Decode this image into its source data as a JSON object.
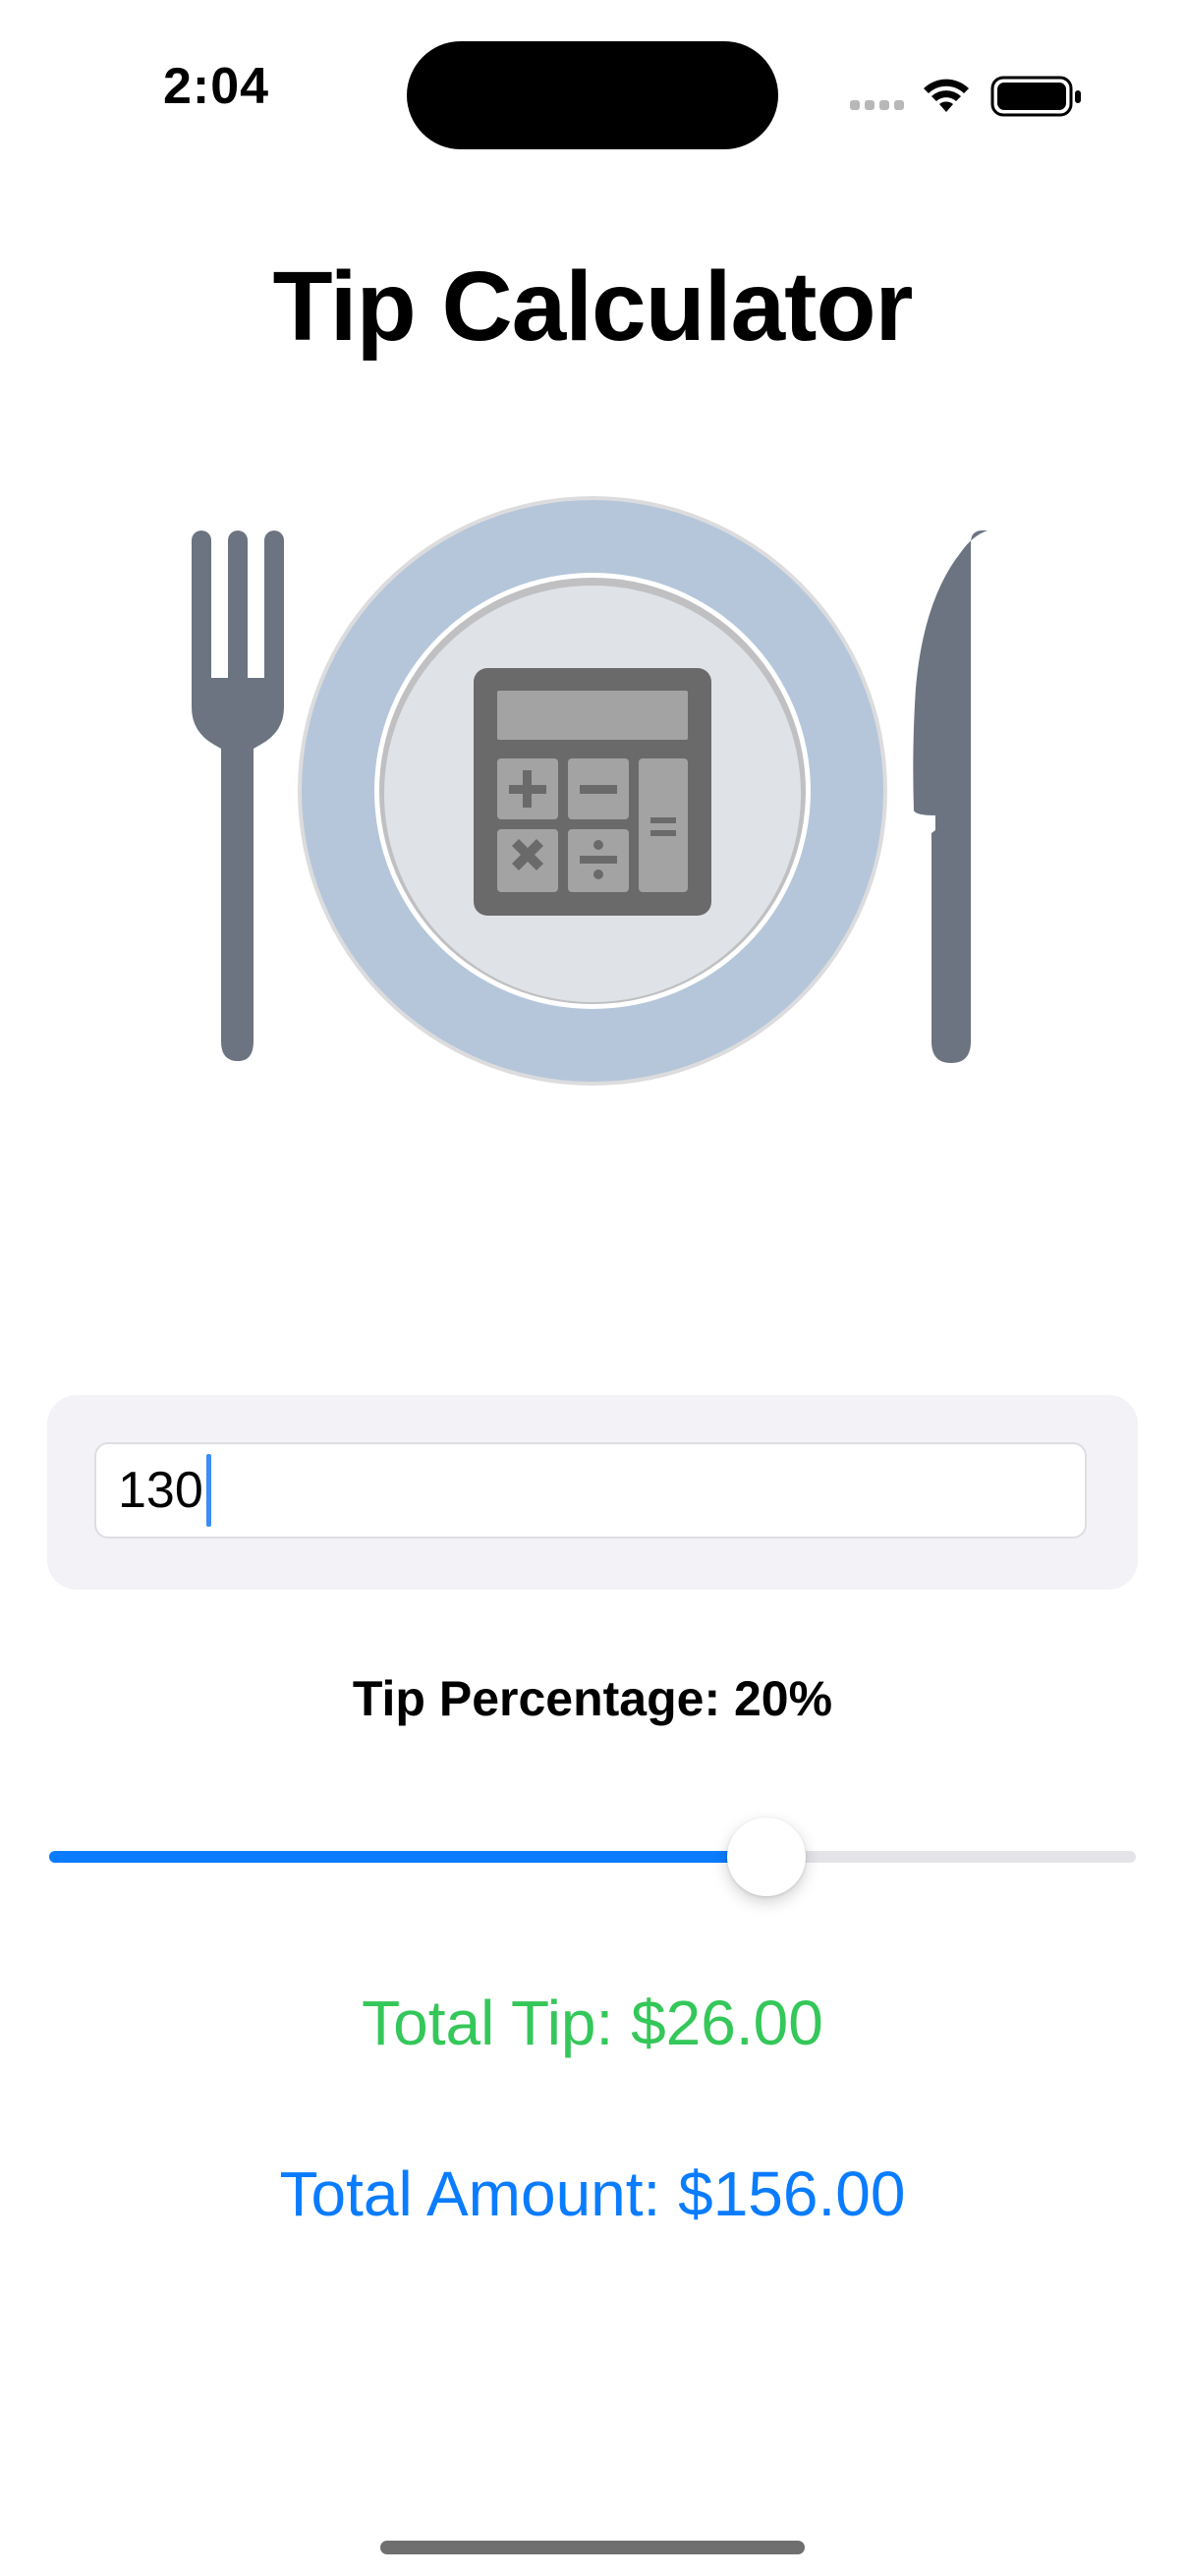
{
  "status_bar": {
    "time": "2:04"
  },
  "app": {
    "title": "Tip Calculator"
  },
  "illustration": {
    "icons": [
      "fork-icon",
      "plate-icon",
      "calculator-icon",
      "knife-icon"
    ]
  },
  "bill_input": {
    "value": "130"
  },
  "tip": {
    "label": "Tip Percentage: 20%",
    "slider_fraction": 0.66
  },
  "results": {
    "total_tip": "Total Tip: $26.00",
    "total_amount": "Total Amount: $156.00"
  },
  "colors": {
    "accent_blue": "#0a7cff",
    "tip_green": "#34c759",
    "amount_blue": "#0a7cff",
    "plate_rim": "#b5c6da",
    "utensil_gray": "#6b7480"
  }
}
